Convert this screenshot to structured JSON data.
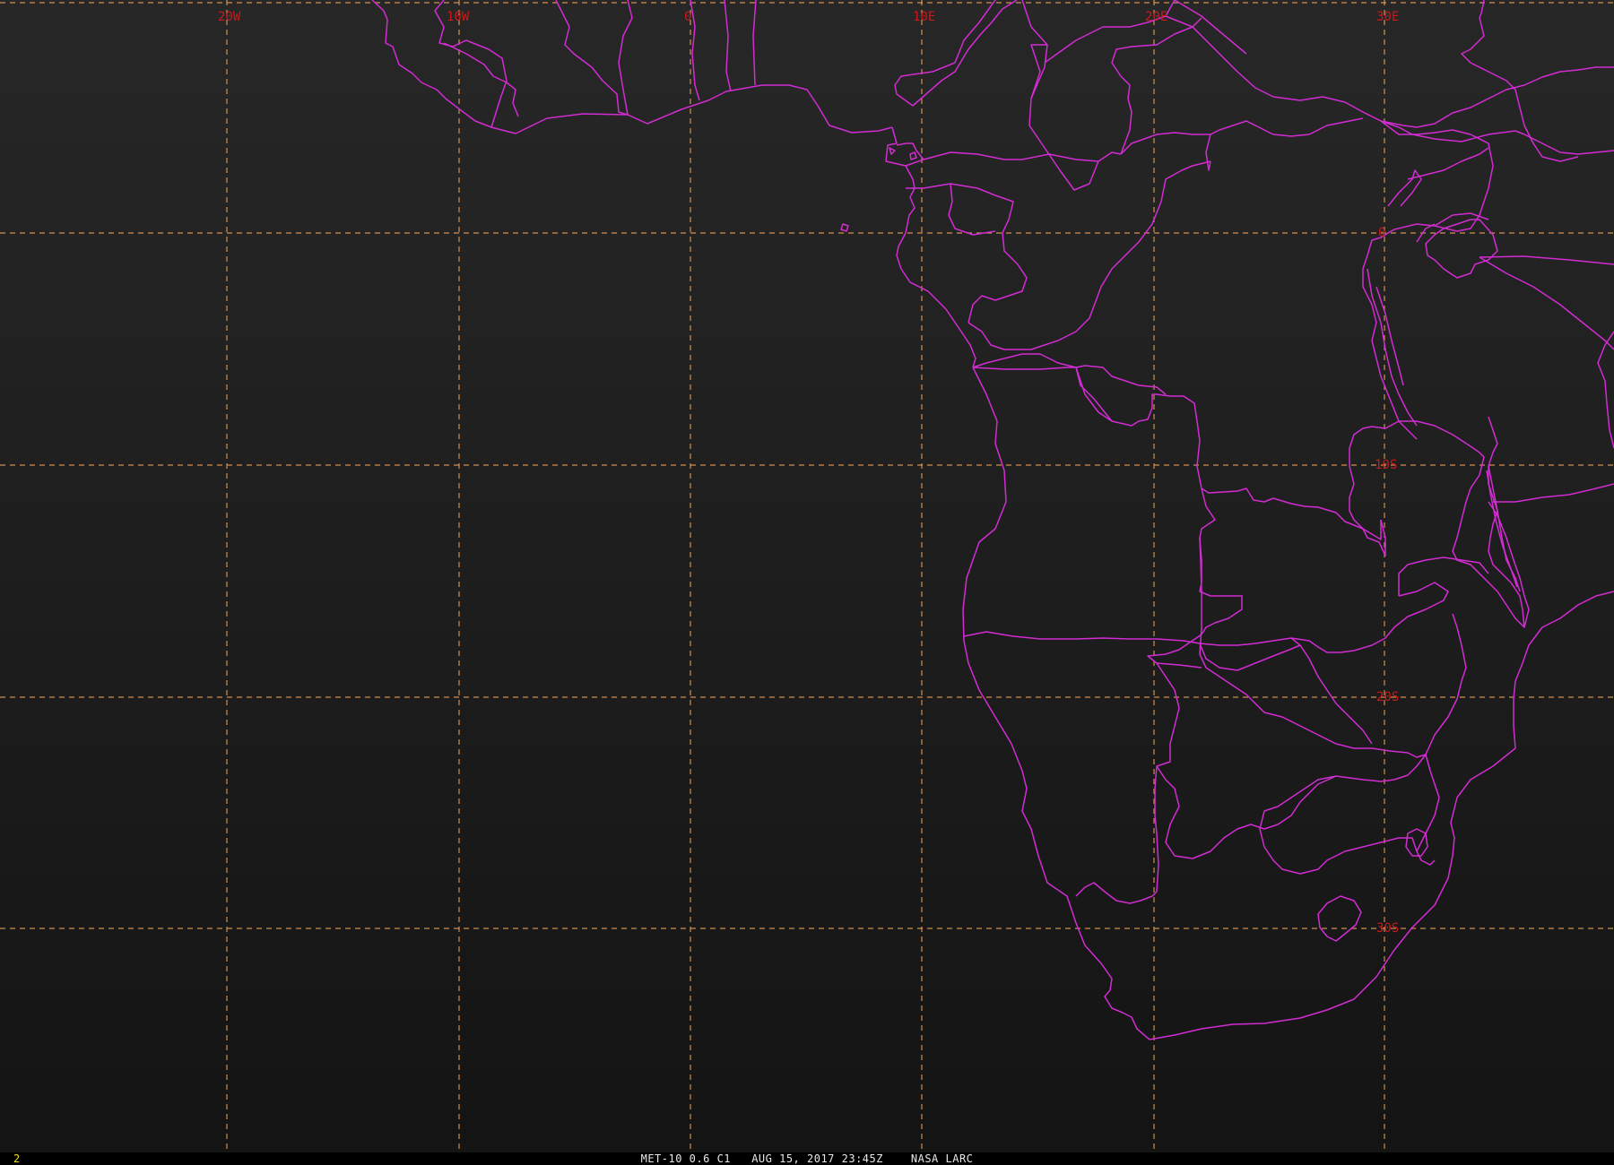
{
  "map": {
    "longitude_labels": [
      "20W",
      "10W",
      "0",
      "10E",
      "20E",
      "30E"
    ],
    "latitude_labels": [
      "0",
      "10S",
      "20S",
      "30S"
    ],
    "colors": {
      "background_top": "#272727",
      "background_bottom": "#141414",
      "grid": "#f0a35a",
      "borders": "#d22cd2",
      "grid_labels": "#c81a1a",
      "frame_number": "#f0e020"
    }
  },
  "status": {
    "frame_number": "2",
    "caption": "MET-10 0.6 C1   AUG 15, 2017 23:45Z    NASA LARC"
  }
}
